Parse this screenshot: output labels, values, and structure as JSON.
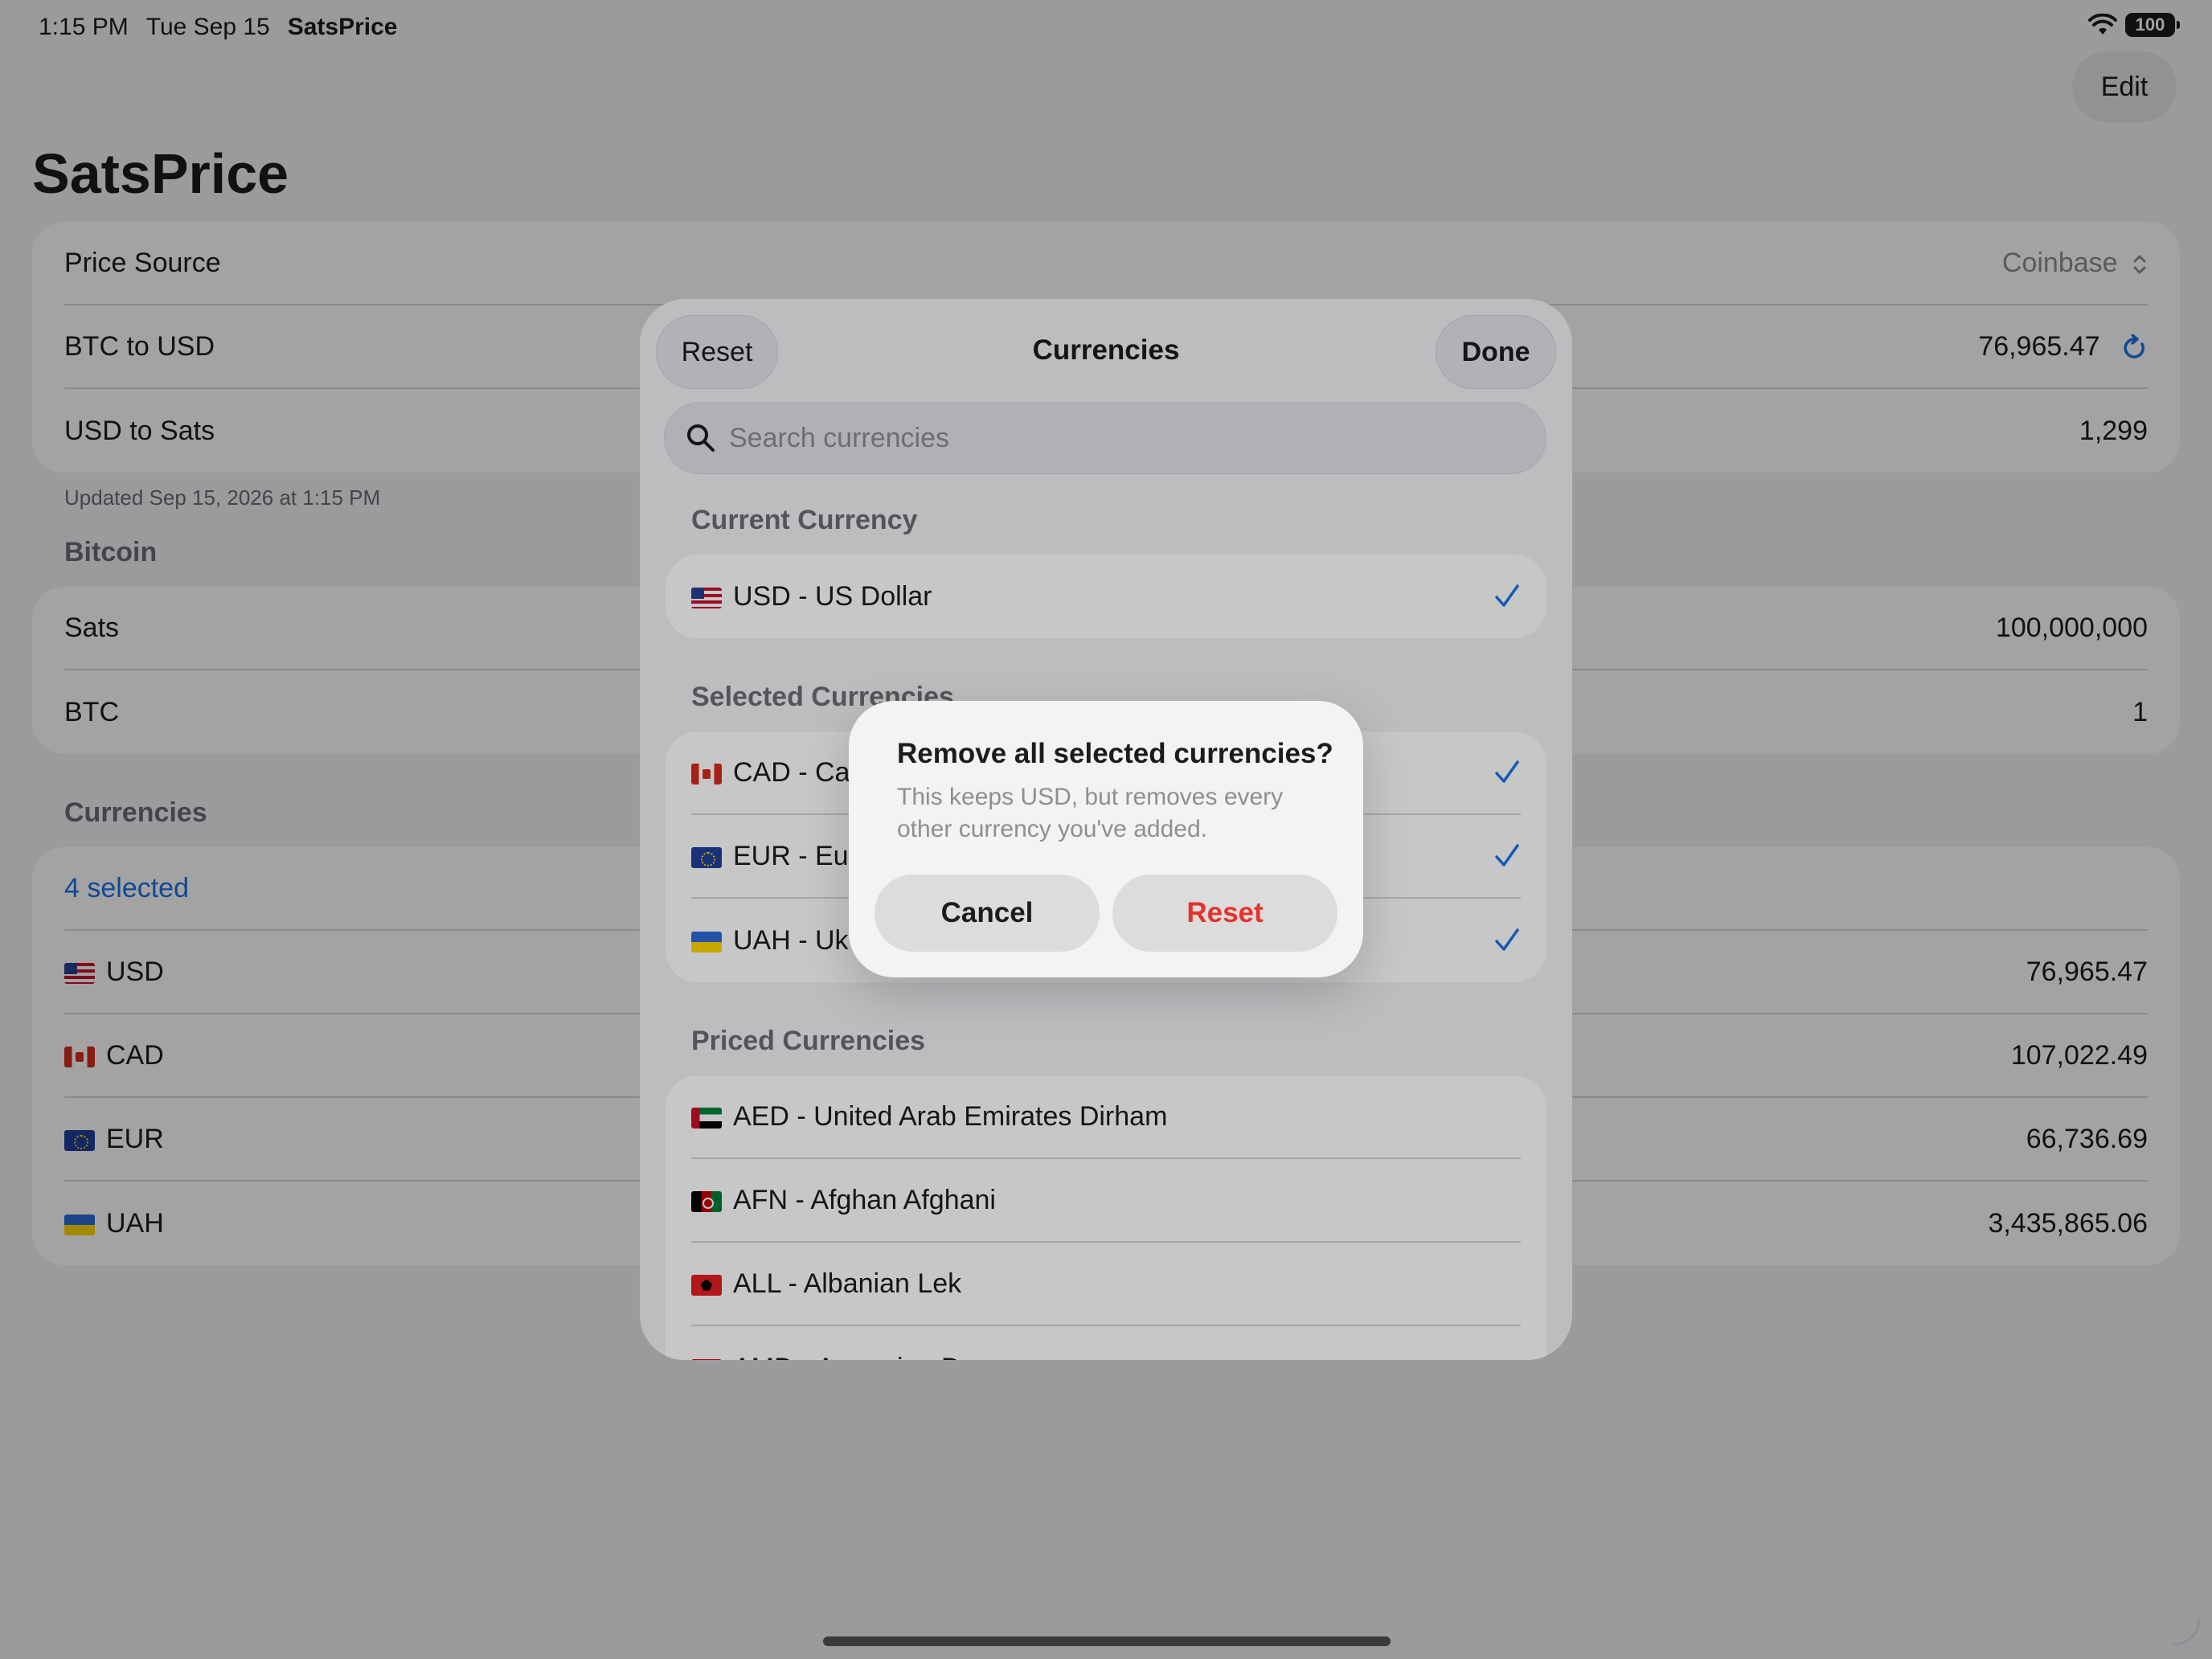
{
  "status": {
    "time": "1:15 PM",
    "date": "Tue Sep 15",
    "app": "SatsPrice",
    "battery": "100"
  },
  "nav": {
    "edit_label": "Edit",
    "title": "SatsPrice"
  },
  "price": {
    "source_label": "Price Source",
    "source_value": "Coinbase",
    "btc_usd_label": "BTC to USD",
    "btc_usd_value": "76,965.47",
    "usd_sats_label": "USD to Sats",
    "usd_sats_value": "1,299",
    "updated": "Updated Sep 15, 2026 at 1:15 PM"
  },
  "bitcoin": {
    "section": "Bitcoin",
    "sats_label": "Sats",
    "sats_value": "100,000,000",
    "btc_label": "BTC",
    "btc_value": "1"
  },
  "currencies": {
    "section": "Currencies",
    "selected_count": "4 selected",
    "rows": [
      {
        "code": "USD",
        "value": "76,965.47"
      },
      {
        "code": "CAD",
        "value": "107,022.49"
      },
      {
        "code": "EUR",
        "value": "66,736.69"
      },
      {
        "code": "UAH",
        "value": "3,435,865.06"
      }
    ]
  },
  "sheet": {
    "reset_label": "Reset",
    "title": "Currencies",
    "done_label": "Done",
    "search_placeholder": "Search currencies",
    "current_section": "Current Currency",
    "current": "USD - US Dollar",
    "selected_section": "Selected Currencies",
    "selected": [
      "CAD - Ca",
      "EUR - Eur",
      "UAH - Uk"
    ],
    "priced_section": "Priced Currencies",
    "priced": [
      "AED - United Arab Emirates Dirham",
      "AFN - Afghan Afghani",
      "ALL - Albanian Lek",
      "AMD - Armenian D"
    ]
  },
  "alert": {
    "title": "Remove all selected currencies?",
    "message": "This keeps USD, but removes every other currency you've added.",
    "cancel_label": "Cancel",
    "reset_label": "Reset"
  },
  "colors": {
    "accent": "#1a73e8",
    "destructive": "#e5322d"
  },
  "icons": [
    "wifi-icon",
    "battery-icon",
    "refresh-icon",
    "chevron-updown-icon",
    "search-icon",
    "checkmark-icon"
  ]
}
